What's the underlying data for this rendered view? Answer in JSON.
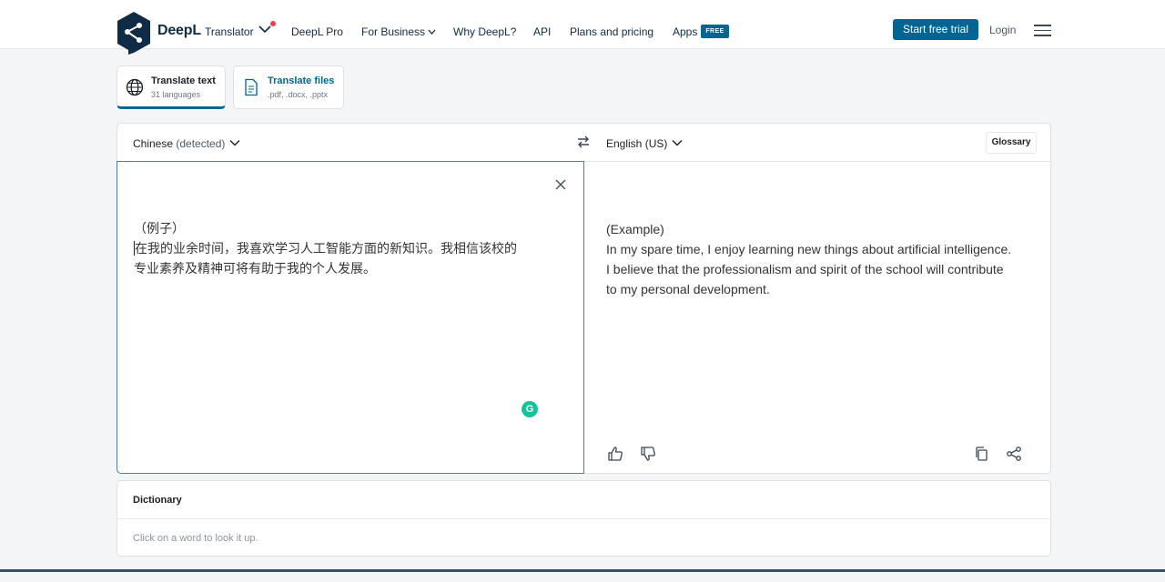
{
  "header": {
    "brand": "DeepL",
    "product": "Translator",
    "nav": [
      "DeepL Pro",
      "For Business",
      "Why DeepL?",
      "API",
      "Plans and pricing",
      "Apps"
    ],
    "apps_badge": "FREE",
    "cta_label": "Start free trial",
    "login_label": "Login"
  },
  "modes": {
    "text": {
      "title": "Translate text",
      "subtitle": "31 languages"
    },
    "files": {
      "title": "Translate files",
      "subtitle": ".pdf, .docx, .pptx"
    }
  },
  "translator": {
    "source_lang": "Chinese",
    "source_detected": "(detected)",
    "target_lang": "English (US)",
    "glossary_label": "Glossary",
    "source_lines": [
      "（例子）",
      "在我的业余时间，我喜欢学习人工智能方面的新知识。我相信该校的",
      "专业素养及精神可将有助于我的个人发展。"
    ],
    "target_lines": [
      "(Example)",
      "In my spare time, I enjoy learning new things about artificial intelligence.",
      "I believe that the professionalism and spirit of the school will contribute",
      "to my personal development."
    ],
    "grammarly_letter": "G"
  },
  "dictionary": {
    "title": "Dictionary",
    "hint": "Click on a word to look it up."
  },
  "colors": {
    "accent": "#006494",
    "brand_navy": "#0f2b46",
    "notification_dot": "#e8404d",
    "grammarly": "#15c39a"
  }
}
